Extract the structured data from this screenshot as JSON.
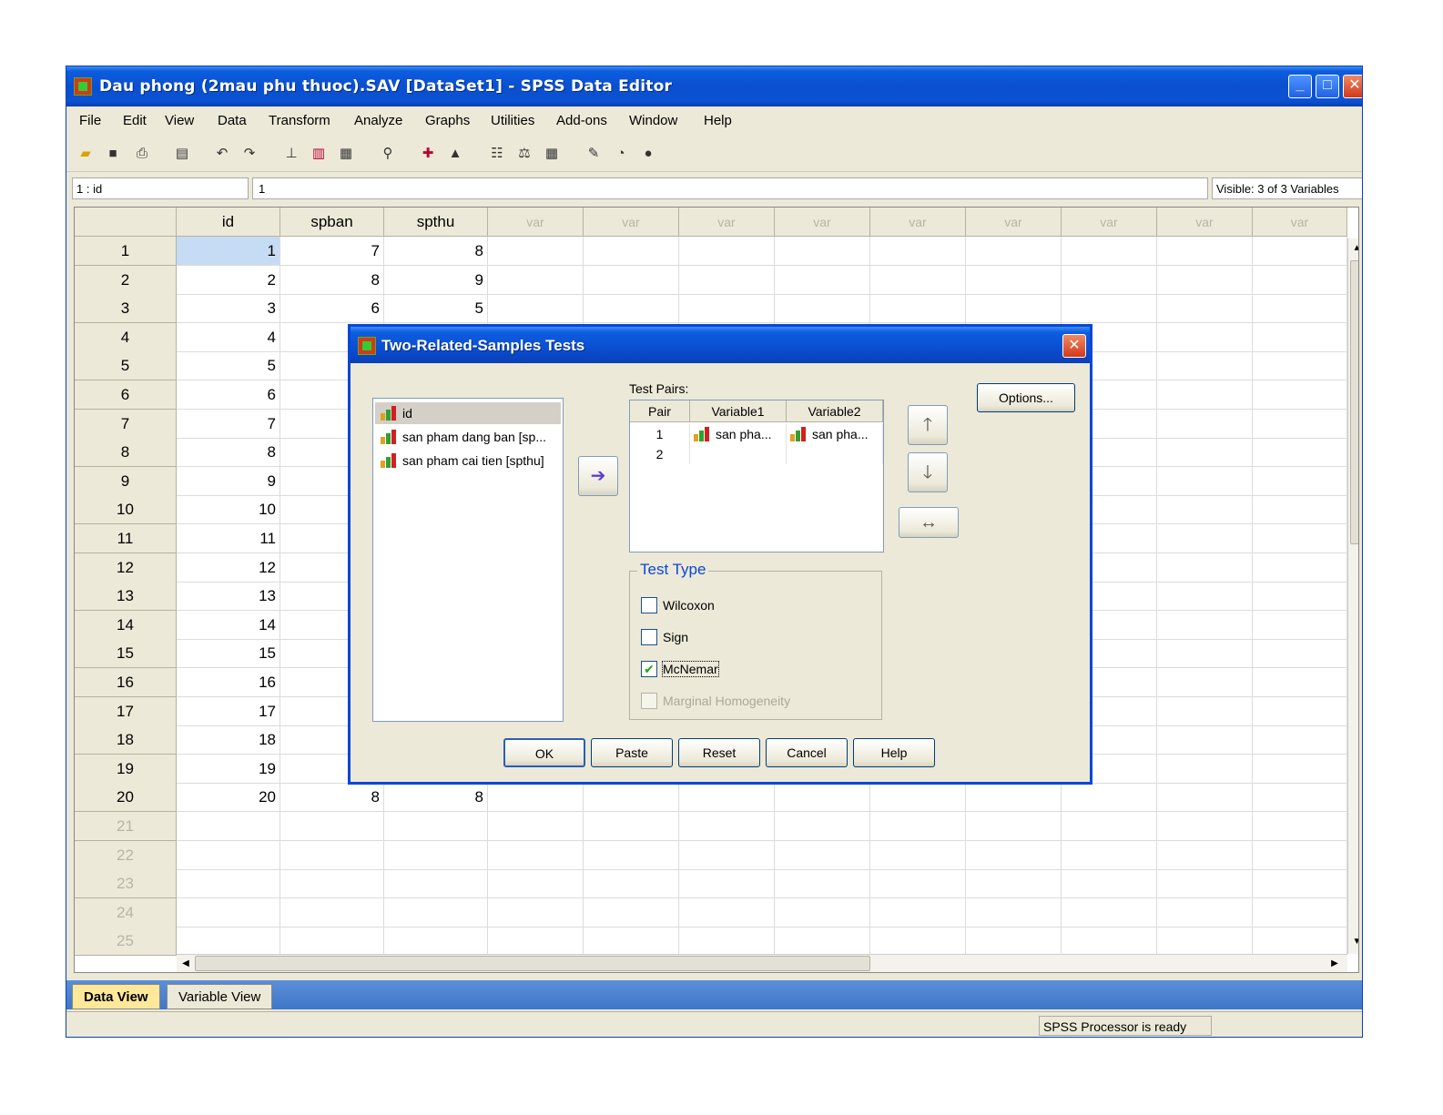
{
  "window": {
    "title": "Dau phong (2mau phu thuoc).SAV [DataSet1] - SPSS Data Editor",
    "minimize": "_",
    "maximize": "□",
    "close": "✕"
  },
  "menu": [
    "File",
    "Edit",
    "View",
    "Data",
    "Transform",
    "Analyze",
    "Graphs",
    "Utilities",
    "Add-ons",
    "Window",
    "Help"
  ],
  "cellbar": {
    "ref": "1 : id",
    "value": "1",
    "visible": "Visible: 3 of 3 Variables"
  },
  "grid": {
    "columns": [
      "id",
      "spban",
      "spthu",
      "var",
      "var",
      "var",
      "var",
      "var",
      "var",
      "var",
      "var",
      "var",
      "var"
    ],
    "row_numbers": [
      "1",
      "2",
      "3",
      "4",
      "5",
      "6",
      "7",
      "8",
      "9",
      "10",
      "11",
      "12",
      "13",
      "14",
      "15",
      "16",
      "17",
      "18",
      "19",
      "20",
      "21",
      "22",
      "23",
      "24",
      "25"
    ],
    "rows": [
      [
        "1",
        "7",
        "8"
      ],
      [
        "2",
        "8",
        "9"
      ],
      [
        "3",
        "6",
        "5"
      ],
      [
        "4",
        "",
        ""
      ],
      [
        "5",
        "",
        ""
      ],
      [
        "6",
        "",
        ""
      ],
      [
        "7",
        "",
        ""
      ],
      [
        "8",
        "",
        ""
      ],
      [
        "9",
        "",
        ""
      ],
      [
        "10",
        "",
        ""
      ],
      [
        "11",
        "",
        ""
      ],
      [
        "12",
        "",
        ""
      ],
      [
        "13",
        "",
        ""
      ],
      [
        "14",
        "",
        ""
      ],
      [
        "15",
        "",
        ""
      ],
      [
        "16",
        "",
        ""
      ],
      [
        "17",
        "",
        ""
      ],
      [
        "18",
        "",
        ""
      ],
      [
        "19",
        "",
        ""
      ],
      [
        "20",
        "8",
        "8"
      ]
    ]
  },
  "tabs": [
    "Data View",
    "Variable View"
  ],
  "status": "SPSS Processor is ready",
  "dialog": {
    "title": "Two-Related-Samples Tests",
    "close": "✕",
    "variables": [
      "id",
      "san pham dang ban [sp...",
      "san pham cai tien [spthu]"
    ],
    "test_pairs_label": "Test Pairs:",
    "pair_headers": [
      "Pair",
      "Variable1",
      "Variable2"
    ],
    "pairs": [
      {
        "n": "1",
        "v1": "san pha...",
        "v2": "san pha..."
      },
      {
        "n": "2",
        "v1": "",
        "v2": ""
      }
    ],
    "test_type_label": "Test Type",
    "tests": [
      {
        "label": "Wilcoxon",
        "checked": false,
        "enabled": true
      },
      {
        "label": "Sign",
        "checked": false,
        "enabled": true
      },
      {
        "label": "McNemar",
        "checked": true,
        "enabled": true
      },
      {
        "label": "Marginal Homogeneity",
        "checked": false,
        "enabled": false
      }
    ],
    "options_label": "Options...",
    "buttons": [
      "OK",
      "Paste",
      "Reset",
      "Cancel",
      "Help"
    ]
  },
  "colors": {
    "title_blue": "#0a4fd0",
    "legend_blue": "#0a46d6",
    "selection": "#c6dcf5",
    "active_tab": "#ffe89a"
  }
}
